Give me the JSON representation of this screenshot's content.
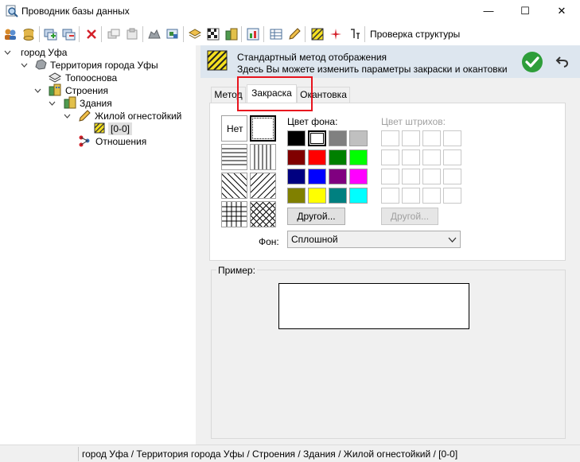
{
  "window": {
    "title": "Проводник базы данных",
    "minimize_glyph": "—",
    "maximize_glyph": "☐",
    "close_glyph": "✕"
  },
  "toolbar": {
    "check_structure_label": "Проверка структуры"
  },
  "tree": {
    "items": [
      {
        "label": "город Уфа",
        "icon": "folder-icon"
      },
      {
        "label": "Территория города Уфы",
        "icon": "territory-icon"
      },
      {
        "label": "Топооснова",
        "icon": "layers-icon"
      },
      {
        "label": "Строения",
        "icon": "buildings-icon"
      },
      {
        "label": "Здания",
        "icon": "buildings-icon"
      },
      {
        "label": "Жилой огнестойкий",
        "icon": "pencil-icon"
      },
      {
        "label": "[0-0]",
        "icon": "hatch-yellow-icon"
      },
      {
        "label": "Отношения",
        "icon": "relations-icon"
      }
    ]
  },
  "header": {
    "line1": "Стандартный метод отображения",
    "line2": "Здесь Вы можете изменить параметры закраски и окантовки",
    "ok_glyph": "✓",
    "undo_glyph": "↶"
  },
  "tabs": [
    {
      "label": "Метод",
      "active": false
    },
    {
      "label": "Закраска",
      "active": true
    },
    {
      "label": "Окантовка",
      "active": false
    }
  ],
  "fill": {
    "pattern_none_label": "Нет",
    "bg_color_label": "Цвет фона:",
    "hatch_color_label": "Цвет штрихов:",
    "other_button_label": "Другой...",
    "other_button_disabled_label": "Другой...",
    "background_label": "Фон:",
    "background_value": "Сплошной",
    "bg_colors": [
      "#000000",
      "#ffffff",
      "#808080",
      "#c0c0c0",
      "#800000",
      "#ff0000",
      "#008000",
      "#00ff00",
      "#000080",
      "#0000ff",
      "#800080",
      "#ff00ff",
      "#808000",
      "#ffff00",
      "#008080",
      "#00ffff"
    ],
    "selected_bg_color": "#ffffff"
  },
  "example": {
    "label": "Пример:"
  },
  "statusbar": {
    "path": "город Уфа / Территория города Уфы / Строения / Здания / Жилой огнестойкий / [0-0]"
  }
}
